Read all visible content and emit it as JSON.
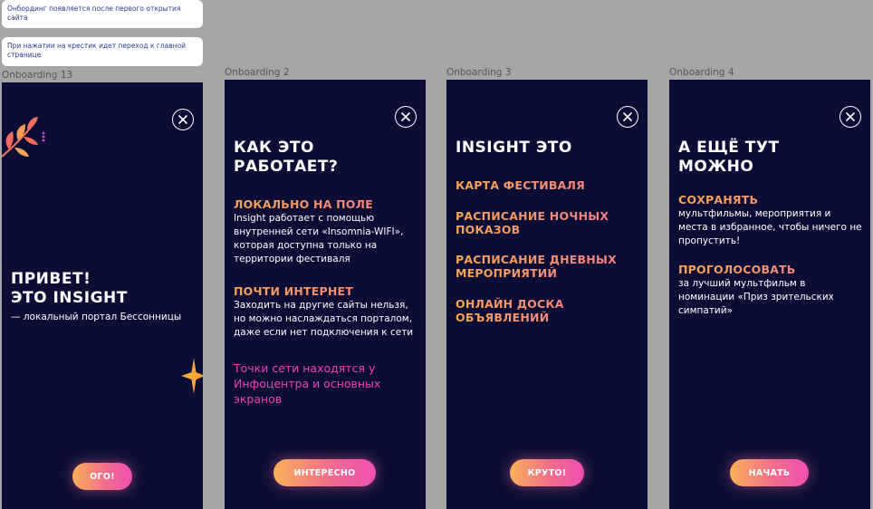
{
  "notes": [
    "Онбординг появляется после первого открытия сайта",
    "При нажатии на крестик идет переход к главной странице"
  ],
  "frames": [
    {
      "label": "Onboarding 13",
      "title_line1": "ПРИВЕТ!",
      "title_line2": "ЭТО INSIGHT",
      "subtitle": "— локальный портал Бессонницы",
      "button": "ОГО!"
    },
    {
      "label": "Onboarding 2",
      "title_line1": "КАК ЭТО",
      "title_line2": "РАБОТАЕТ?",
      "section1_heading": "ЛОКАЛЬНО НА ПОЛЕ",
      "section1_text": "Insight работает с помощью внутренней сети «Insomnia-WIFI», которая доступна только на территории фестиваля",
      "section2_heading": "ПОЧТИ ИНТЕРНЕТ",
      "section2_text": "Заходить на другие сайты нельзя, но можно наслаждаться порталом, даже если нет подключения к сети",
      "highlight": "Точки сети находятся у Инфоцентра и основных экранов",
      "button": "ИНТЕРЕСНО"
    },
    {
      "label": "Onboarding 3",
      "title": "INSIGHT ЭТО",
      "items": [
        "КАРТА ФЕСТИВАЛЯ",
        "РАСПИСАНИЕ НОЧНЫХ ПОКАЗОВ",
        "РАСПИСАНИЕ ДНЕВНЫХ МЕРОПРИЯТИЙ",
        "ОНЛАЙН ДОСКА ОБЪЯВЛЕНИЙ"
      ],
      "button": "КРУТО!"
    },
    {
      "label": "Onboarding 4",
      "title_line1": "А ЕЩЁ ТУТ",
      "title_line2": "МОЖНО",
      "section1_heading": "СОХРАНЯТЬ",
      "section1_text": "мультфильмы, мероприятия и места в избранное, чтобы ничего не пропустить!",
      "section2_heading": "ПРОГОЛОСОВАТЬ",
      "section2_text": "за лучший мультфильм в номинации «Приз зрительских симпатий»",
      "button": "НАЧАТЬ"
    }
  ],
  "icons": {
    "close": "close-icon",
    "leaf": "leaf-decoration-icon",
    "sparkle": "sparkle-star-icon"
  },
  "colors": {
    "frame_bg": "#0b0d35",
    "accent_orange": "#f7a656",
    "accent_pink": "#f040b4",
    "canvas": "#a6a6a6"
  }
}
